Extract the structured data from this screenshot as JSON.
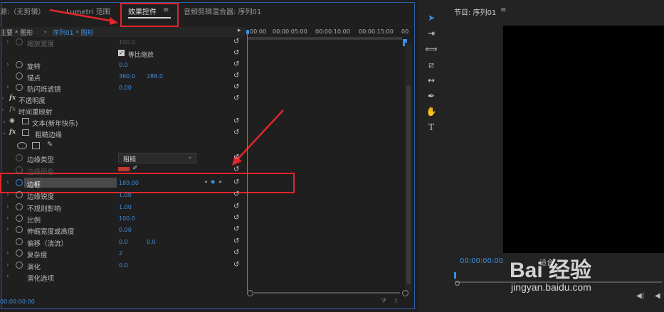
{
  "tabs": [
    {
      "label": "源:（无剪辑）"
    },
    {
      "label": "Lumetri 范围"
    },
    {
      "label": "效果控件"
    },
    {
      "label": "音频剪辑混合器: 序列01"
    }
  ],
  "sub_header": {
    "master": "主要 * 图形",
    "sequence": "序列01 * 图形"
  },
  "timecodes": [
    "00:00",
    "00:00:05:00",
    "00:00:10:00",
    "00:00:15:00",
    "00"
  ],
  "rows": {
    "scale_width": {
      "label": "缩放宽度",
      "value": "100.0"
    },
    "uniform_scale": {
      "label": "等比缩放"
    },
    "rotation": {
      "label": "旋转",
      "value": "0.0"
    },
    "anchor": {
      "label": "锚点",
      "x": "360.0",
      "y": "288.0"
    },
    "antiflicker": {
      "label": "防闪烁滤镜",
      "value": "0.00"
    },
    "opacity": {
      "label": "不透明度"
    },
    "time_remap": {
      "label": "时间重映射"
    },
    "text_layer": {
      "label": "文本(新年快乐)"
    },
    "rough_edges": {
      "label": "粗糙边缘"
    },
    "edge_type": {
      "label": "边缘类型",
      "value": "粗糙"
    },
    "edge_color": {
      "label": "边缘颜色"
    },
    "border": {
      "label": "边框",
      "value": "189.00"
    },
    "edge_sharpness": {
      "label": "边缘锐度",
      "value": "1.00"
    },
    "fractal_influence": {
      "label": "不规则影响",
      "value": "1.00"
    },
    "scale": {
      "label": "比例",
      "value": "100.0"
    },
    "stretch": {
      "label": "伸缩宽度或高度",
      "value": "0.00"
    },
    "offset": {
      "label": "偏移（湍流）",
      "x": "0.0",
      "y": "0.0"
    },
    "complexity": {
      "label": "复杂度",
      "value": "2"
    },
    "evolution": {
      "label": "演化",
      "value": "0.0"
    },
    "evolution_options": {
      "label": "演化选项"
    }
  },
  "bottom_timecode": "00:00:00:00",
  "program": {
    "title": "节目: 序列01",
    "timecode": "00:00:00:00",
    "fit": "适合"
  },
  "watermark": {
    "brand": "Bai 经验",
    "url": "jingyan.baidu.com"
  },
  "colors": {
    "accent_blue": "#3d8ee0",
    "annotation_red": "#e2262a",
    "panel_border": "#2f5fa8"
  }
}
